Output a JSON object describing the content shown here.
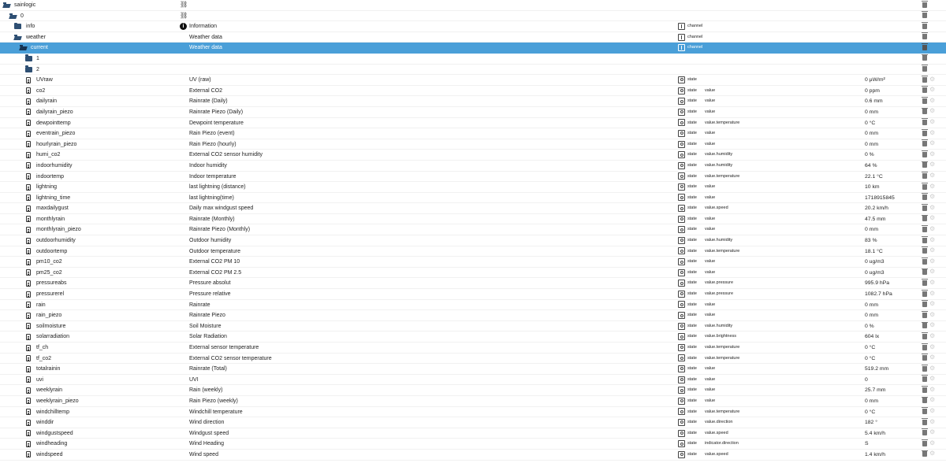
{
  "tree": {
    "root": {
      "label": "sainlogic",
      "icon": "network-icon"
    },
    "instance": {
      "label": "0",
      "icon": "network-icon"
    },
    "info": {
      "label": "info",
      "name": "Information",
      "role": "channel"
    },
    "weather": {
      "label": "weather",
      "name": "Weather data",
      "role": "channel"
    },
    "current": {
      "label": "current",
      "name": "Weather data",
      "role": "channel"
    },
    "folder1": {
      "label": "1"
    },
    "folder2": {
      "label": "2"
    },
    "states": [
      {
        "id": "UVraw",
        "name": "UV (raw)",
        "type": "state",
        "role": "",
        "value": "0 µW/m²"
      },
      {
        "id": "co2",
        "name": "External CO2",
        "type": "state",
        "role": "value",
        "value": "0 ppm"
      },
      {
        "id": "dailyrain",
        "name": "Rainrate (Daily)",
        "type": "state",
        "role": "value",
        "value": "0.6 mm"
      },
      {
        "id": "dailyrain_piezo",
        "name": "Rainrate Piezo (Daily)",
        "type": "state",
        "role": "value",
        "value": "0 mm"
      },
      {
        "id": "dewpointtemp",
        "name": "Dewpoint temperature",
        "type": "state",
        "role": "value.temperature",
        "value": "0 °C"
      },
      {
        "id": "eventrain_piezo",
        "name": "Rain Piezo (event)",
        "type": "state",
        "role": "value",
        "value": "0 mm"
      },
      {
        "id": "hourlyrain_piezo",
        "name": "Rain Piezo (hourly)",
        "type": "state",
        "role": "value",
        "value": "0 mm"
      },
      {
        "id": "humi_co2",
        "name": "External CO2 sensor humidity",
        "type": "state",
        "role": "value.humidity",
        "value": "0 %"
      },
      {
        "id": "indoorhumidity",
        "name": "Indoor humidity",
        "type": "state",
        "role": "value.humidity",
        "value": "64 %"
      },
      {
        "id": "indoortemp",
        "name": "Indoor temperature",
        "type": "state",
        "role": "value.temperature",
        "value": "22.1 °C"
      },
      {
        "id": "lightning",
        "name": "last lightning (distance)",
        "type": "state",
        "role": "value",
        "value": "10 km"
      },
      {
        "id": "lightning_time",
        "name": "last lightning(time)",
        "type": "state",
        "role": "value",
        "value": "1718915845"
      },
      {
        "id": "maxdailygust",
        "name": "Daily max windgust speed",
        "type": "state",
        "role": "value.speed",
        "value": "20.2 km/h"
      },
      {
        "id": "monthlyrain",
        "name": "Rainrate (Monthly)",
        "type": "state",
        "role": "value",
        "value": "47.5 mm"
      },
      {
        "id": "monthlyrain_piezo",
        "name": "Rainrate Piezo (Monthly)",
        "type": "state",
        "role": "value",
        "value": "0 mm"
      },
      {
        "id": "outdoorhumidity",
        "name": "Outdoor humidity",
        "type": "state",
        "role": "value.humidity",
        "value": "83 %"
      },
      {
        "id": "outdoortemp",
        "name": "Outdoor temperature",
        "type": "state",
        "role": "value.temperature",
        "value": "18.1 °C"
      },
      {
        "id": "pm10_co2",
        "name": "External CO2 PM 10",
        "type": "state",
        "role": "value",
        "value": "0 ug/m3"
      },
      {
        "id": "pm25_co2",
        "name": "External CO2 PM 2.5",
        "type": "state",
        "role": "value",
        "value": "0 ug/m3"
      },
      {
        "id": "pressureabs",
        "name": "Pressure absolut",
        "type": "state",
        "role": "value.pressure",
        "value": "995.9 hPa"
      },
      {
        "id": "pressurerel",
        "name": "Pressure relative",
        "type": "state",
        "role": "value.pressure",
        "value": "1082.7 hPa"
      },
      {
        "id": "rain",
        "name": "Rainrate",
        "type": "state",
        "role": "value",
        "value": "0 mm"
      },
      {
        "id": "rain_piezo",
        "name": "Rainrate Piezo",
        "type": "state",
        "role": "value",
        "value": "0 mm"
      },
      {
        "id": "soilmoisture",
        "name": "Soil Moisture",
        "type": "state",
        "role": "value.humidity",
        "value": "0 %"
      },
      {
        "id": "solarradiation",
        "name": "Solar Radiation",
        "type": "state",
        "role": "value.brightness",
        "value": "604 lx"
      },
      {
        "id": "tf_ch",
        "name": "External sensor temperature",
        "type": "state",
        "role": "value.temperature",
        "value": "0 °C"
      },
      {
        "id": "tf_co2",
        "name": "External CO2 sensor temperature",
        "type": "state",
        "role": "value.temperature",
        "value": "0 °C"
      },
      {
        "id": "totalrainin",
        "name": "Rainrate (Total)",
        "type": "state",
        "role": "value",
        "value": "519.2 mm"
      },
      {
        "id": "uvi",
        "name": "UVI",
        "type": "state",
        "role": "value",
        "value": "0"
      },
      {
        "id": "weeklyrain",
        "name": "Rain (weekly)",
        "type": "state",
        "role": "value",
        "value": "25.7 mm"
      },
      {
        "id": "weeklyrain_piezo",
        "name": "Rain Piezo (weekly)",
        "type": "state",
        "role": "value",
        "value": "0 mm"
      },
      {
        "id": "windchilltemp",
        "name": "Windchill temperature",
        "type": "state",
        "role": "value.temperature",
        "value": "0 °C"
      },
      {
        "id": "winddir",
        "name": "Wind direction",
        "type": "state",
        "role": "value.direction",
        "value": "182 °"
      },
      {
        "id": "windgustspeed",
        "name": "Windgust speed",
        "type": "state",
        "role": "value.speed",
        "value": "5.4 km/h"
      },
      {
        "id": "windheading",
        "name": "Wind Heading",
        "type": "state",
        "role": "indicator.direction",
        "value": "S"
      },
      {
        "id": "windspeed",
        "name": "Wind speed",
        "type": "state",
        "role": "value.speed",
        "value": "1.4 km/h"
      }
    ]
  },
  "colors": {
    "selected_row": "#4a9fd8",
    "folder": "#2e4f73"
  }
}
